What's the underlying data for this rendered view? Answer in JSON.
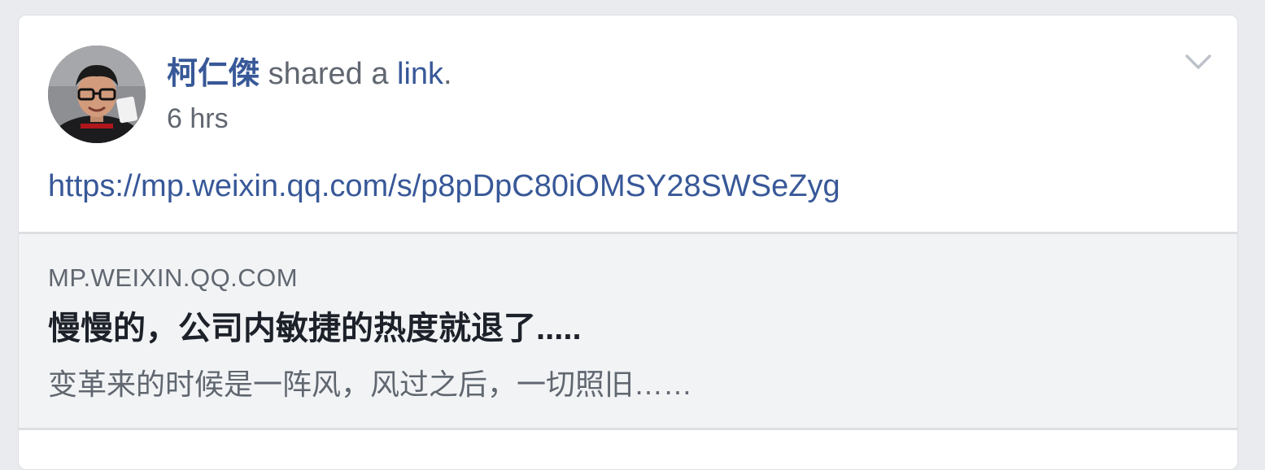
{
  "post": {
    "author": "柯仁傑",
    "action_text": " shared a ",
    "action_link": "link",
    "action_end": ".",
    "timestamp": "6 hrs",
    "url": "https://mp.weixin.qq.com/s/p8pDpC80iOMSY28SWSeZyg"
  },
  "preview": {
    "domain": "MP.WEIXIN.QQ.COM",
    "title": "慢慢的，公司内敏捷的热度就退了.....",
    "description": "变革来的时候是一阵风，风过之后，一切照旧……"
  },
  "icons": {
    "menu": "chevron-down-icon"
  },
  "colors": {
    "link": "#385898",
    "secondary_text": "#616770",
    "page_background": "#e9ebee",
    "preview_background": "#f2f3f5"
  }
}
